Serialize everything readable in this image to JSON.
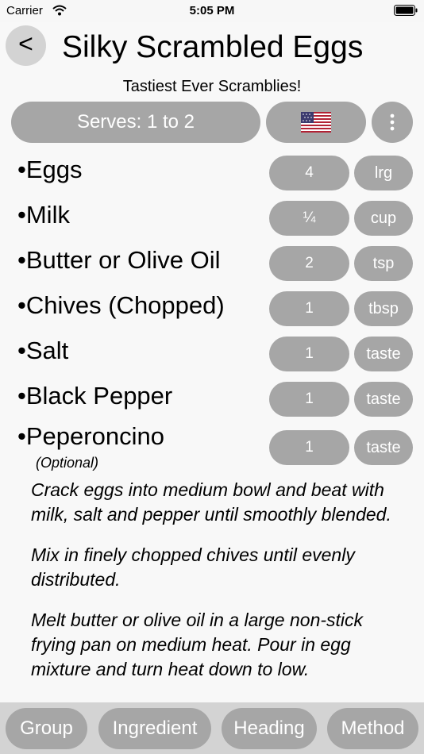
{
  "status_bar": {
    "carrier": "Carrier",
    "time": "5:05 PM"
  },
  "header": {
    "back_label": "<",
    "title": "Silky Scrambled Eggs",
    "subtitle": "Tastiest Ever Scramblies!"
  },
  "toolbar": {
    "serves_label": "Serves: 1 to 2",
    "flag_icon": "us-flag-icon",
    "more_icon": "vertical-ellipsis-icon"
  },
  "ingredients": [
    {
      "bullet": "•",
      "name": "Eggs",
      "qty": "4",
      "unit": "lrg"
    },
    {
      "bullet": "•",
      "name": "Milk",
      "qty": "¼",
      "unit": "cup"
    },
    {
      "bullet": "•",
      "name": "Butter or Olive Oil",
      "qty": "2",
      "unit": "tsp"
    },
    {
      "bullet": "•",
      "name": "Chives (Chopped)",
      "qty": "1",
      "unit": "tbsp"
    },
    {
      "bullet": "•",
      "name": "Salt",
      "qty": "1",
      "unit": "taste"
    },
    {
      "bullet": "•",
      "name": "Black Pepper",
      "qty": "1",
      "unit": "taste"
    },
    {
      "bullet": "•",
      "name": "Peperoncino",
      "qty": "1",
      "unit": "taste",
      "note": "(Optional)"
    }
  ],
  "method_steps": [
    "Crack eggs into medium bowl and beat with milk, salt and pepper until smoothly blended.",
    "Mix in finely chopped chives until evenly distributed.",
    "Melt butter or olive oil in a large non-stick frying pan on medium heat. Pour in egg mixture and turn heat down to low."
  ],
  "bottom_bar": {
    "group_label": "Group",
    "ingredient_label": "Ingredient",
    "heading_label": "Heading",
    "method_label": "Method"
  },
  "colors": {
    "pill": "#a6a6a6",
    "back_button": "#d3d3d3",
    "bottom_bar": "#d3d3d3",
    "background": "#f8f8f8",
    "flag_red": "#b22234",
    "flag_blue": "#3c3b6e"
  }
}
